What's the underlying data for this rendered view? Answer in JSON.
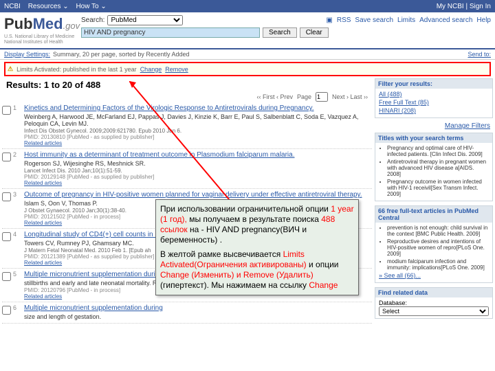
{
  "topbar": {
    "l1": "NCBI",
    "l2": "Resources ⌄",
    "l3": "How To ⌄",
    "r": "My NCBI | Sign In"
  },
  "logo": {
    "t1": "Pub",
    "t2": "Med",
    "gov": ".gov",
    "sub": "U.S. National Library of Medicine\nNational Institutes of Health"
  },
  "search": {
    "label": "Search:",
    "db": "PubMed",
    "query": "HIV AND pregnancy",
    "btn_search": "Search",
    "btn_clear": "Clear"
  },
  "toplinks": {
    "rss": "RSS",
    "save": "Save search",
    "limits": "Limits",
    "adv": "Advanced search",
    "help": "Help"
  },
  "bar1": {
    "disp": "Display Settings:",
    "summary": "Summary, 20 per page, sorted by Recently Added",
    "send": "Send to:"
  },
  "limits": {
    "warn": "⚠",
    "text": "Limits Activated: published in the last 1 year",
    "change": "Change",
    "remove": "Remove"
  },
  "results_hdr": "Results: 1 to 20 of 488",
  "pager": {
    "prev": "‹‹ First ‹ Prev",
    "page": "Page",
    "num": "1",
    "next": "Next › Last ››"
  },
  "results": [
    {
      "n": "1",
      "title": "Kinetics and Determining Factors of the Virologic Response to Antiretrovirals during Pregnancy.",
      "authors": "Weinberg A, Harwood JE, McFarland EJ, Pappas J, Davies J, Kinzie K, Barr E, Paul S, Salbenblatt C, Soda E, Vazquez A, Peloquin CA, Levin MJ.",
      "journal": "Infect Dis Obstet Gynecol. 2009;2009:621780. Epub 2010 Jan 6.",
      "pmid": "PMID: 20130810 [PubMed - as supplied by publisher]",
      "rel": "Related articles"
    },
    {
      "n": "2",
      "title": "Host immunity as a determinant of treatment outcome in Plasmodium falciparum malaria.",
      "authors": "Rogerson SJ, Wijesinghe RS, Meshnick SR.",
      "journal": "Lancet Infect Dis. 2010 Jan;10(1):51-59.",
      "pmid": "PMID: 20129148 [PubMed - as supplied by publisher]",
      "rel": "Related articles"
    },
    {
      "n": "3",
      "title": "Outcome of pregnancy in HIV-positive women planned for vaginal delivery under effective antiretroviral therapy.",
      "authors": "Islam S, Oon V, Thomas P.",
      "journal": "J Obstet Gynaecol. 2010 Jan;30(1):38-40.",
      "pmid": "PMID: 20121502 [PubMed - in process]",
      "rel": "Related articles"
    },
    {
      "n": "4",
      "title": "Longitudinal study of CD4(+) cell counts in HIV-",
      "authors": "Towers CV, Rumney PJ, Ghamsary MC.",
      "journal": "J Matern Fetal Neonatal Med. 2010 Feb 1. [Epub ah",
      "pmid": "PMID: 20121389 [PubMed - as supplied by publisher]",
      "rel": "Related articles"
    },
    {
      "n": "5",
      "title": "Multiple micronutrient supplementation during p",
      "authors": "stillbirths and early and late neonatal mortality.\nRonsmans C, Fisher DJ, Osmond C, Margetts B",
      "journal": "",
      "pmid": "PMID: 20120796 [PubMed - in process]",
      "rel": "Related articles"
    },
    {
      "n": "6",
      "title": "Multiple micronutrient supplementation during",
      "authors": "size and length of gestation.",
      "journal": "",
      "pmid": "",
      "rel": ""
    }
  ],
  "side": {
    "filter_hd": "Filter your results:",
    "filters": [
      {
        "t": "All (488)"
      },
      {
        "t": "Free Full Text (85)"
      },
      {
        "t": "HINARI (208)"
      }
    ],
    "manage": "Manage Filters",
    "titles_hd": "Titles with your search terms",
    "titles": [
      "Pregnancy and optimal care of HIV-infected patients. [Clin Infect Dis. 2009]",
      "Antiretroviral therapy in pregnant women with advanced HIV disease a[AIDS. 2008]",
      "Pregnancy outcome in women infected with HIV-1 receivil[Sex Transm Infect. 2009]"
    ],
    "central_hd": "66 free full-text articles in PubMed Central",
    "central": [
      "prevention is not enough: child survival in the context [BMC Public Health. 2009]",
      "Reproductive desires and intentions of HIV-positive women of repro[PLoS One. 2009]",
      "modium falciparum infection and immunity: implications[PLoS One. 2009]"
    ],
    "see_all": "» See all (66)...",
    "related_hd": "Find related data",
    "db_lbl": "Database:",
    "db_sel": "Select"
  },
  "callout": {
    "p1a": "При использовании ограничительной опции ",
    "p1r": "1 year (1 год),",
    "p1b": " мы получаем в результате поиска ",
    "p1r2": "488 ссылок ",
    "p1c": "на - HIV AND pregnancy(ВИЧ и беременность) .",
    "p2a": "В желтой рамке высвечивается ",
    "p2r": "Limits Activated(Ограничения активированы) ",
    "p2b": "и опции ",
    "p2r2": "Change (Изменить) и Remove (Удалить) ",
    "p2c": " (гипертекст). Мы нажимаем на ссылку ",
    "p2r3": "Change"
  }
}
